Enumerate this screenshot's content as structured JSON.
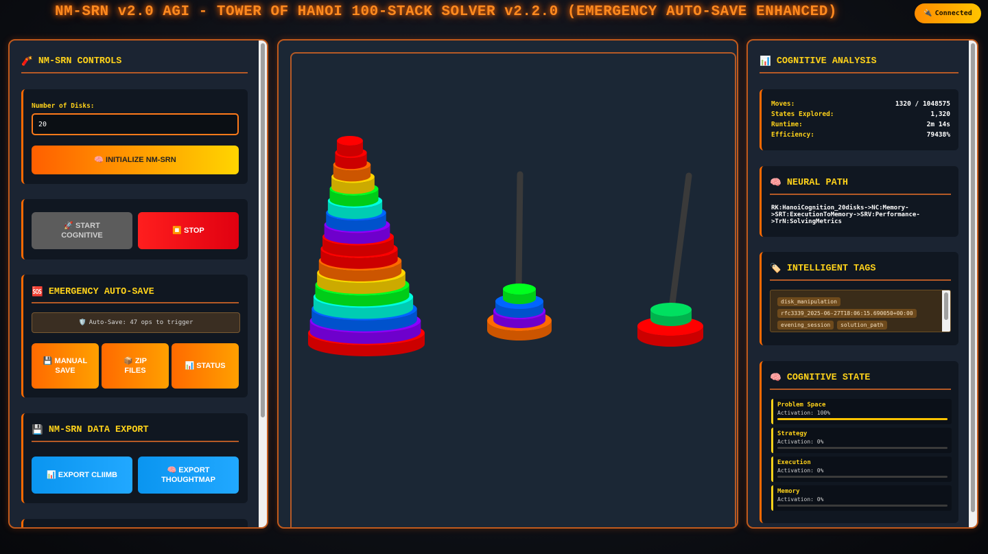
{
  "header": {
    "title": "NM-SRN v2.0 AGI - TOWER OF HANOI 100-STACK SOLVER v2.2.0 (EMERGENCY AUTO-SAVE ENHANCED)",
    "connection_icon": "plug-icon",
    "connection_label": "Connected"
  },
  "left": {
    "controls_title": "NM-SRN CONTROLS",
    "controls_icon": "rocket-icon",
    "disks_label": "Number of Disks:",
    "disks_value": "20",
    "init_label": "🧠 INITIALIZE NM-SRN",
    "start_label": "🚀 START COGNITIVE",
    "stop_label": "⏹️ STOP",
    "autosave_title": "EMERGENCY AUTO-SAVE",
    "autosave_icon": "sos-icon",
    "autosave_status": "Auto-Save: 47 ops to trigger",
    "manual_save_label": "💾 MANUAL SAVE",
    "zip_label": "📦 ZIP FILES",
    "status_label": "📊 STATUS",
    "export_title": "NM-SRN DATA EXPORT",
    "export_icon": "floppy-disk-icon",
    "export_climb_label": "📊 EXPORT CLIIMB",
    "export_thoughtmap_label": "🧠 EXPORT THOUGHTMAP"
  },
  "right": {
    "analysis_title": "COGNITIVE ANALYSIS",
    "analysis_icon": "bar-chart-icon",
    "stats": [
      {
        "key": "Moves:",
        "value": "1320 / 1048575"
      },
      {
        "key": "States Explored:",
        "value": "1,320"
      },
      {
        "key": "Runtime:",
        "value": "2m 14s"
      },
      {
        "key": "Efficiency:",
        "value": "79438%"
      }
    ],
    "neural_title": "NEURAL PATH",
    "neural_icon": "brain-icon",
    "neural_lines": [
      "RK:HanoiCognition_20disks->NC:Memory-",
      ">SRT:ExecutionToMemory->SRV:Performance-",
      ">TrN:SolvingMetrics"
    ],
    "tags_title": "INTELLIGENT TAGS",
    "tags_icon": "tag-icon",
    "tags": [
      "disk_manipulation",
      "rfc3339_2025-06-27T18:06:15.690050+00:00",
      "evening_session",
      "solution_path"
    ],
    "state_title": "COGNITIVE STATE",
    "state_icon": "brain-icon",
    "states": [
      {
        "name": "Problem Space",
        "activation": "Activation: 100%",
        "level": 1.0
      },
      {
        "name": "Strategy",
        "activation": "Activation: 0%",
        "level": 0
      },
      {
        "name": "Execution",
        "activation": "Activation: 0%",
        "level": 0
      },
      {
        "name": "Memory",
        "activation": "Activation: 0%",
        "level": 0
      }
    ]
  },
  "tower": {
    "disk_colors": [
      "#ff0000",
      "#ff6a00",
      "#ffd400",
      "#00ff1e",
      "#00ffe0",
      "#0066ff",
      "#8a00ff"
    ],
    "peg_color": "#3a3a3a",
    "rod_counts": [
      17,
      2,
      1
    ]
  }
}
